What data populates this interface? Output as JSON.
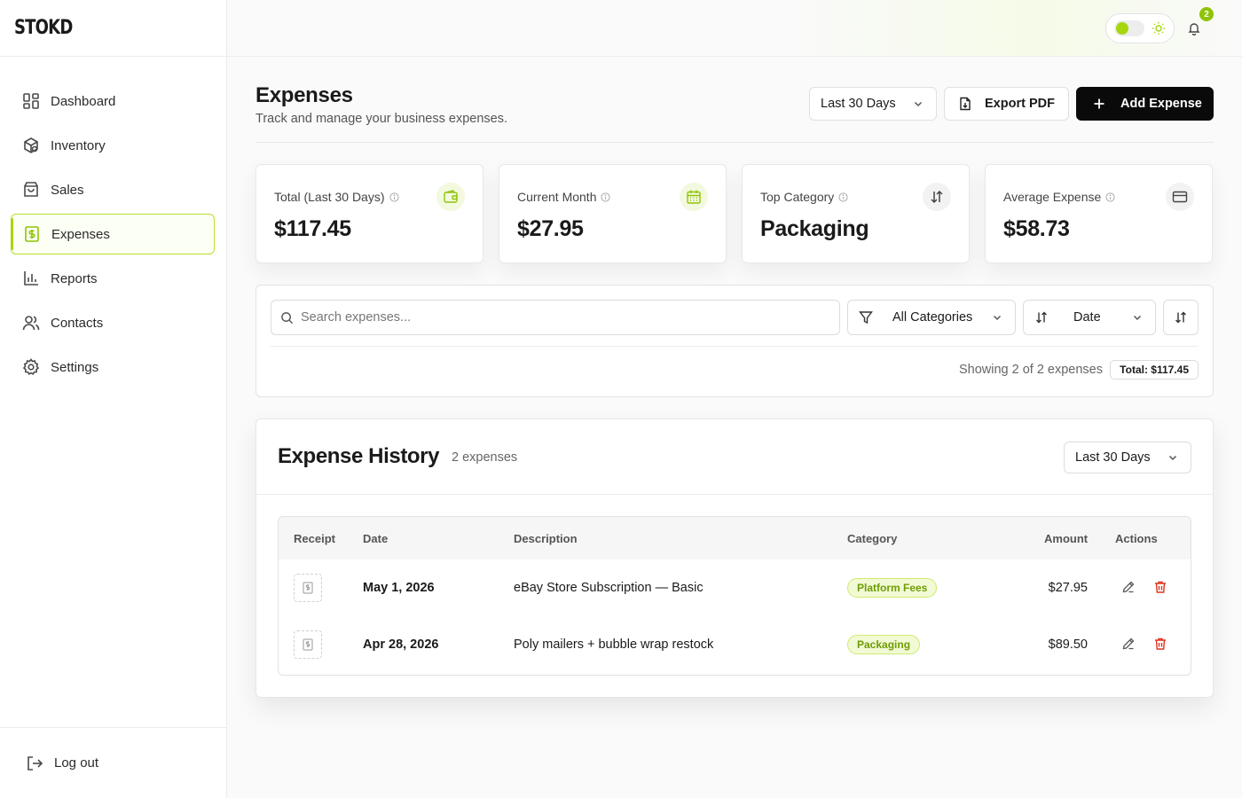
{
  "brand": "STOKD",
  "sidebar": {
    "items": [
      {
        "label": "Dashboard",
        "icon": "dashboard-grid-icon"
      },
      {
        "label": "Inventory",
        "icon": "package-icon"
      },
      {
        "label": "Sales",
        "icon": "shopping-bag-icon"
      },
      {
        "label": "Expenses",
        "icon": "dollar-receipt-icon",
        "active": true
      },
      {
        "label": "Reports",
        "icon": "bar-chart-icon"
      },
      {
        "label": "Contacts",
        "icon": "users-icon"
      },
      {
        "label": "Settings",
        "icon": "gear-icon"
      }
    ],
    "logout": "Log out"
  },
  "topbar": {
    "notification_count": "2"
  },
  "page": {
    "title": "Expenses",
    "subtitle": "Track and manage your business expenses.",
    "range_label": "Last 30 Days",
    "export_label": "Export PDF",
    "add_label": "Add Expense"
  },
  "stats": [
    {
      "label": "Total (Last 30 Days)",
      "value": "$117.45",
      "icon": "wallet-icon"
    },
    {
      "label": "Current Month",
      "value": "$27.95",
      "icon": "calendar-icon"
    },
    {
      "label": "Top Category",
      "value": "Packaging",
      "icon": "sort-arrows-icon"
    },
    {
      "label": "Average Expense",
      "value": "$58.73",
      "icon": "credit-card-icon"
    }
  ],
  "filters": {
    "search_placeholder": "Search expenses...",
    "category": "All Categories",
    "sort_by": "Date",
    "showing": "Showing 2 of 2 expenses",
    "total": "Total: $117.45"
  },
  "history": {
    "title": "Expense History",
    "count": "2 expenses",
    "range_label": "Last 30 Days",
    "columns": [
      "Receipt",
      "Date",
      "Description",
      "Category",
      "Amount",
      "Actions"
    ],
    "rows": [
      {
        "date": "May 1, 2026",
        "description": "eBay Store Subscription — Basic",
        "category": "Platform Fees",
        "amount": "$27.95"
      },
      {
        "date": "Apr 28, 2026",
        "description": "Poly mailers + bubble wrap restock",
        "category": "Packaging",
        "amount": "$89.50"
      }
    ]
  },
  "colors": {
    "accent": "#a6d60f",
    "danger": "#e0341c",
    "primary_button": "#0a0a0a"
  }
}
